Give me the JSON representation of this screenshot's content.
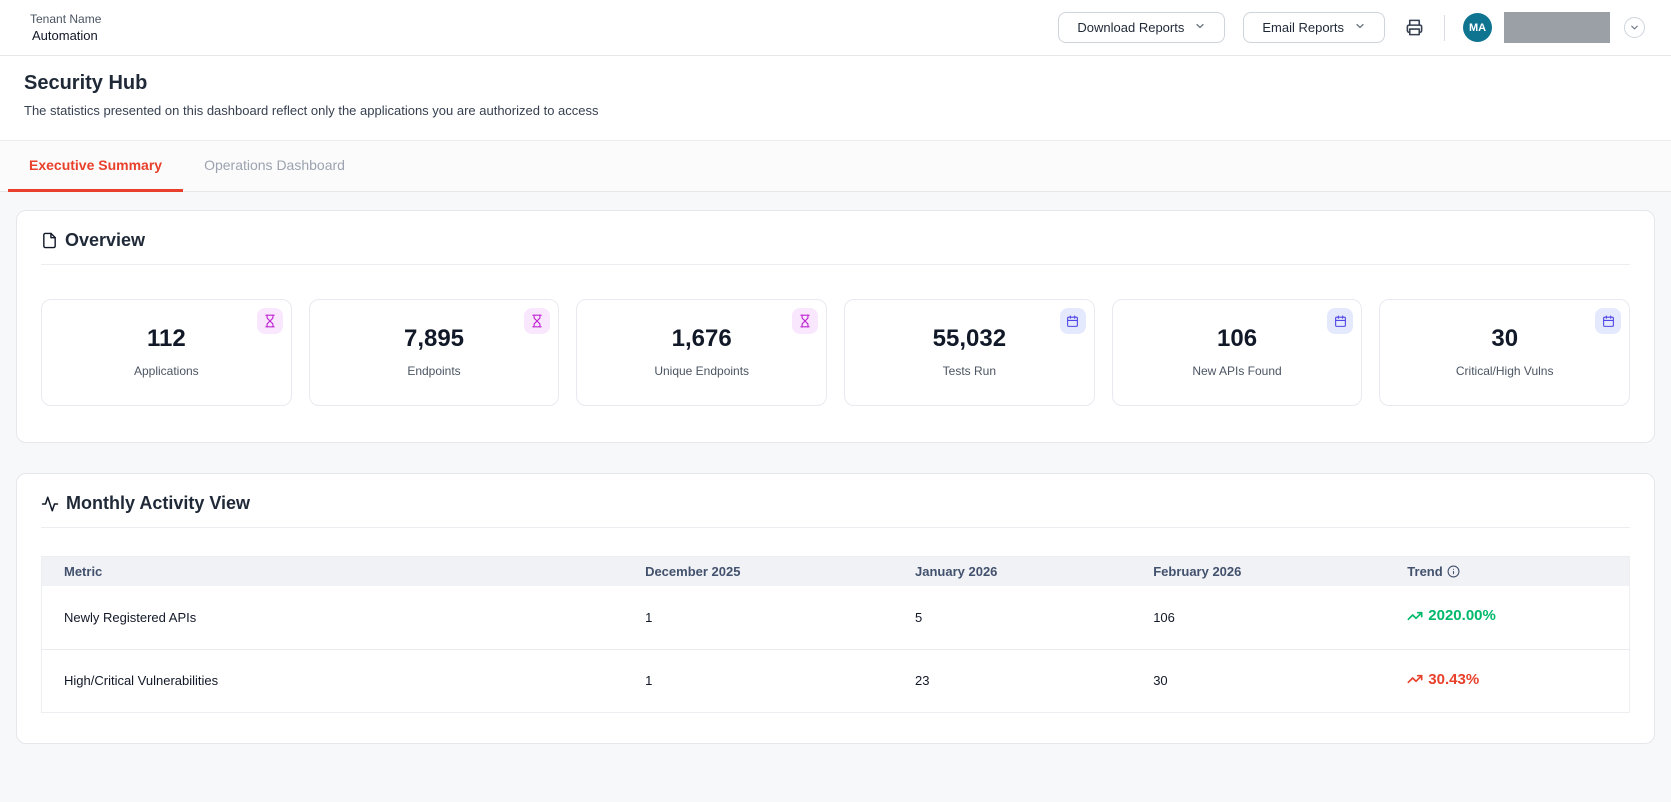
{
  "header": {
    "tenant_label": "Tenant Name",
    "tenant_value": "Automation",
    "download_reports": "Download Reports",
    "email_reports": "Email Reports",
    "avatar_initials": "MA"
  },
  "page": {
    "title": "Security Hub",
    "subtitle": "The statistics presented on this dashboard reflect only the applications you are authorized to access"
  },
  "tabs": [
    {
      "label": "Executive Summary",
      "active": true
    },
    {
      "label": "Operations Dashboard",
      "active": false
    }
  ],
  "overview": {
    "title": "Overview",
    "stats": [
      {
        "value": "112",
        "label": "Applications",
        "icon": "hourglass-icon"
      },
      {
        "value": "7,895",
        "label": "Endpoints",
        "icon": "hourglass-icon"
      },
      {
        "value": "1,676",
        "label": "Unique Endpoints",
        "icon": "hourglass-icon"
      },
      {
        "value": "55,032",
        "label": "Tests Run",
        "icon": "calendar-icon"
      },
      {
        "value": "106",
        "label": "New APIs Found",
        "icon": "calendar-icon"
      },
      {
        "value": "30",
        "label": "Critical/High Vulns",
        "icon": "calendar-icon"
      }
    ]
  },
  "monthly_activity": {
    "title": "Monthly Activity View",
    "columns": [
      "Metric",
      "December 2025",
      "January 2026",
      "February 2026",
      "Trend"
    ],
    "rows": [
      {
        "metric": "Newly Registered APIs",
        "december_2025": "1",
        "january_2026": "5",
        "february_2026": "106",
        "trend": "2020.00%",
        "trend_direction": "up",
        "trend_color": "#00b96b"
      },
      {
        "metric": "High/Critical Vulnerabilities",
        "december_2025": "1",
        "january_2026": "23",
        "february_2026": "30",
        "trend": "30.43%",
        "trend_direction": "up",
        "trend_color": "#e8402a"
      }
    ]
  },
  "colors": {
    "active_tab": "#e8402a",
    "trend_up_green": "#00b96b",
    "trend_up_red": "#e8402a",
    "avatar_bg": "#0e7490",
    "stat_icon_purple": "#c026d3",
    "stat_icon_blue": "#4f46e5"
  }
}
